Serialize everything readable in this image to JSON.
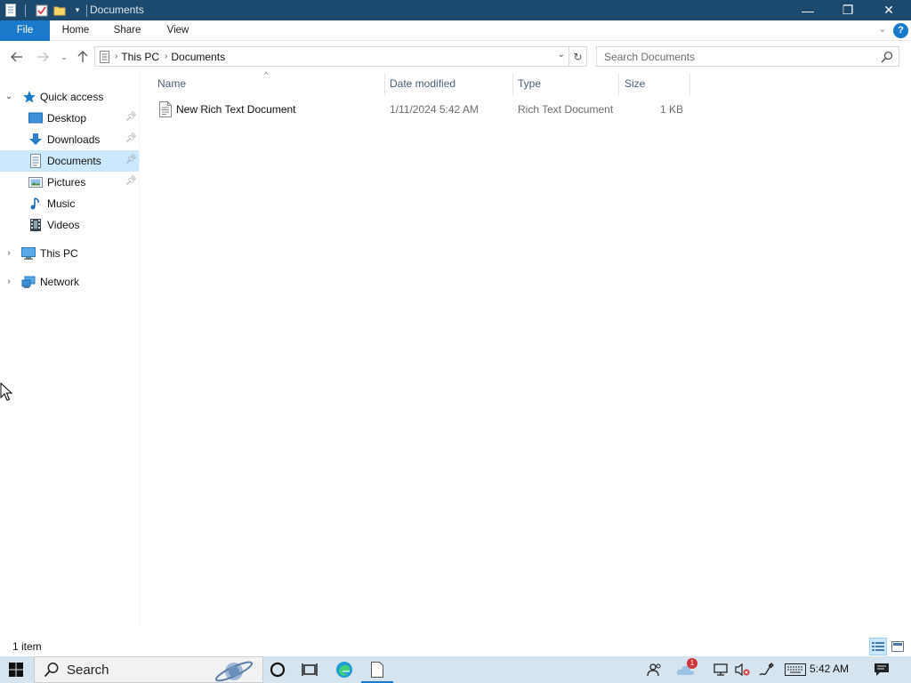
{
  "window": {
    "title": "Documents",
    "controls": {
      "minimize": "—",
      "maximize": "❐",
      "close": "✕"
    }
  },
  "ribbon": {
    "tabs": [
      "File",
      "Home",
      "Share",
      "View"
    ],
    "help": "?"
  },
  "address": {
    "breadcrumb": [
      "This PC",
      "Documents"
    ],
    "search_placeholder": "Search Documents"
  },
  "nav_pane": {
    "quick_access": "Quick access",
    "pinned": [
      {
        "label": "Desktop",
        "icon": "desktop-icon",
        "pinned": true
      },
      {
        "label": "Downloads",
        "icon": "downloads-icon",
        "pinned": true
      },
      {
        "label": "Documents",
        "icon": "documents-icon",
        "pinned": true,
        "selected": true
      },
      {
        "label": "Pictures",
        "icon": "pictures-icon",
        "pinned": true
      },
      {
        "label": "Music",
        "icon": "music-icon",
        "pinned": false
      },
      {
        "label": "Videos",
        "icon": "videos-icon",
        "pinned": false
      }
    ],
    "this_pc": "This PC",
    "network": "Network"
  },
  "file_list": {
    "columns": [
      "Name",
      "Date modified",
      "Type",
      "Size"
    ],
    "sort_column": "Name",
    "rows": [
      {
        "name": "New Rich Text Document",
        "date": "1/11/2024 5:42 AM",
        "type": "Rich Text Document",
        "size": "1 KB"
      }
    ]
  },
  "status": {
    "item_count": "1 item"
  },
  "taskbar": {
    "search_label": "Search",
    "clock": "5:42 AM",
    "notification_badge": "1"
  },
  "colors": {
    "titlebar": "#1c4a6e",
    "accent": "#1979ca",
    "selection": "#cce8ff",
    "taskbar": "#d6e4ef"
  }
}
